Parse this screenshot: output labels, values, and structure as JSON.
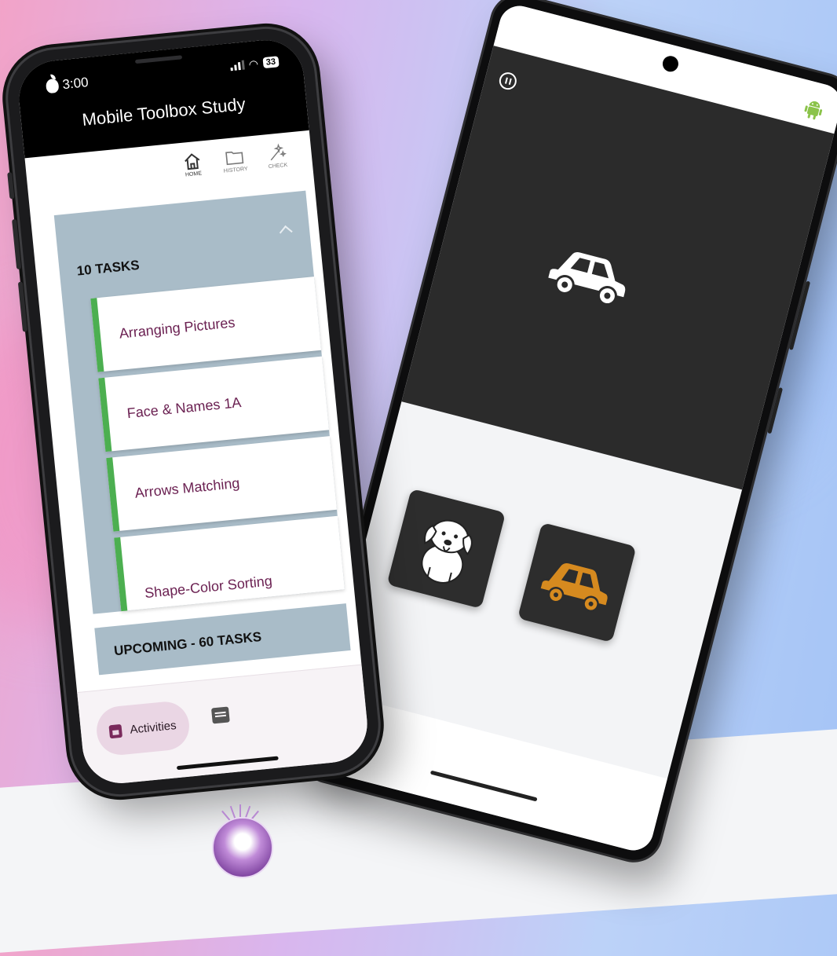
{
  "ios": {
    "status": {
      "time": "3:00",
      "battery": "33"
    },
    "title": "Mobile Toolbox Study",
    "tabs": [
      {
        "label": "HOME",
        "icon": "home-icon"
      },
      {
        "label": "HISTORY",
        "icon": "folder-icon"
      },
      {
        "label": "CHECK",
        "icon": "sparkle-icon"
      }
    ],
    "today": {
      "heading": "10 TASKS",
      "tasks": [
        "Arranging Pictures",
        "Face & Names 1A",
        "Arrows Matching",
        "Shape-Color Sorting"
      ]
    },
    "upcoming": "UPCOMING - 60 TASKS",
    "nav": {
      "activities_label": "Activities"
    },
    "colors": {
      "task_accent": "#4caf50",
      "task_text": "#6b2152",
      "panel": "#a9bcc8",
      "nav_pill": "#ead6e4"
    }
  },
  "android": {
    "target_icon": "car-icon",
    "choices": [
      {
        "icon": "dog-icon",
        "color": "#ffffff"
      },
      {
        "icon": "car-icon",
        "color": "#d68a1f"
      }
    ],
    "colors": {
      "game_bg": "#2b2b2b",
      "android_logo": "#8bc34a"
    }
  }
}
